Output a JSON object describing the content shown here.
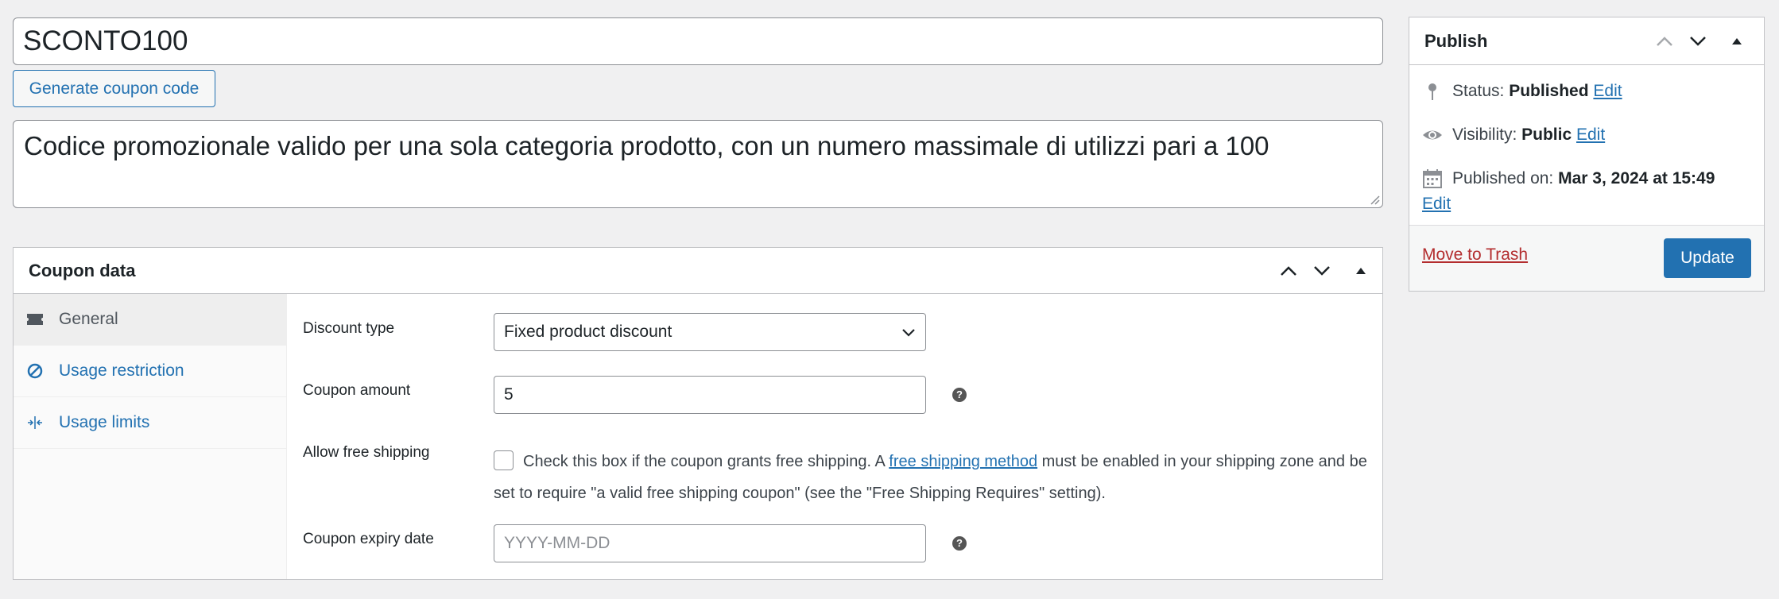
{
  "coupon": {
    "code": "SCONTO100",
    "generate_label": "Generate coupon code",
    "description": "Codice promozionale valido per una sola categoria prodotto, con un numero massimale di utilizzi pari a 100"
  },
  "coupon_data": {
    "title": "Coupon data",
    "tabs": [
      {
        "label": "General",
        "icon": "ticket-icon",
        "active": true
      },
      {
        "label": "Usage restriction",
        "icon": "block-icon",
        "active": false
      },
      {
        "label": "Usage limits",
        "icon": "limits-icon",
        "active": false
      }
    ],
    "general": {
      "discount_type_label": "Discount type",
      "discount_type_value": "Fixed product discount",
      "amount_label": "Coupon amount",
      "amount_value": "5",
      "free_shipping_label": "Allow free shipping",
      "free_shipping_checked": false,
      "free_shipping_text_before": "Check this box if the coupon grants free shipping. A ",
      "free_shipping_link": "free shipping method",
      "free_shipping_text_after": " must be enabled in your shipping zone and be set to require \"a valid free shipping coupon\" (see the \"Free Shipping Requires\" setting).",
      "expiry_label": "Coupon expiry date",
      "expiry_placeholder": "YYYY-MM-DD",
      "help_glyph": "?"
    }
  },
  "publish": {
    "title": "Publish",
    "status_label": "Status: ",
    "status_value": "Published",
    "visibility_label": "Visibility: ",
    "visibility_value": "Public",
    "published_label": "Published on: ",
    "published_value": "Mar 3, 2024 at 15:49",
    "edit_label": "Edit",
    "trash_label": "Move to Trash",
    "update_label": "Update"
  },
  "colors": {
    "accent": "#2271b1",
    "danger": "#b32d2e",
    "background": "#f0f0f1"
  }
}
